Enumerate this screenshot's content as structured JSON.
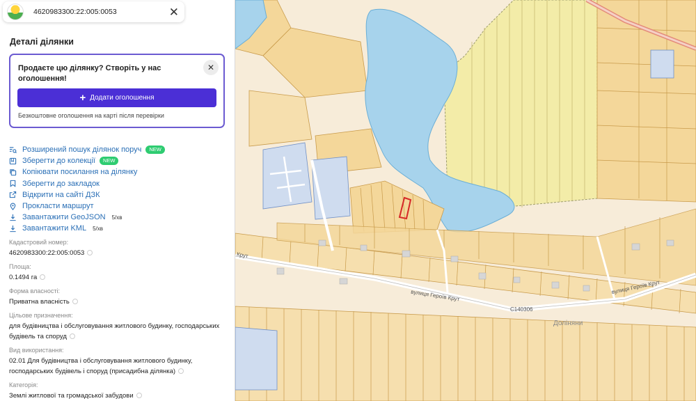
{
  "search": {
    "value": "4620983300:22:005:0053"
  },
  "details": {
    "title": "Деталі ділянки"
  },
  "promo": {
    "text": "Продаєте цю ділянку? Створіть у нас оголошення!",
    "button": "Додати оголошення",
    "note": "Безкоштовне оголошення на карті після перевірки"
  },
  "actions": [
    {
      "label": "Розширений пошук ділянок поруч",
      "icon": "list-search-icon",
      "badge": "NEW"
    },
    {
      "label": "Зберегти до колекції",
      "icon": "collection-icon",
      "badge": "NEW"
    },
    {
      "label": "Копіювати посилання на ділянку",
      "icon": "copy-icon"
    },
    {
      "label": "Зберегти до закладок",
      "icon": "bookmark-icon"
    },
    {
      "label": "Відкрити на сайті ДЗК",
      "icon": "external-link-icon"
    },
    {
      "label": "Прокласти маршрут",
      "icon": "map-pin-icon"
    },
    {
      "label": "Завантажити GeoJSON",
      "icon": "download-icon",
      "quota": "5/хв"
    },
    {
      "label": "Завантажити KML",
      "icon": "download-icon",
      "quota": "5/хв"
    }
  ],
  "properties": [
    {
      "label": "Кадастровий номер:",
      "value": "4620983300:22:005:0053"
    },
    {
      "label": "Площа:",
      "value": "0.1494 га"
    },
    {
      "label": "Форма власності:",
      "value": "Приватна власність"
    },
    {
      "label": "Цільове призначення:",
      "value": "для будівництва і обслуговування житлового будинку, господарських будівель та споруд"
    },
    {
      "label": "Вид використання:",
      "value": "02.01 Для будівництва і обслуговування житлового будинку, господарських будівель і споруд (присадибна ділянка)"
    },
    {
      "label": "Категорія:",
      "value": "Землі житлової та громадської забудови"
    }
  ],
  "map": {
    "street_left": "Крут",
    "street_center": "вулиця Героїв Крут",
    "street_right": "вулиця Героїв Крут",
    "road_code": "C140306",
    "settlement": "Доліняни"
  },
  "colors": {
    "accent": "#4b2fd6",
    "link": "#2a6fb6",
    "badge": "#2ecc71",
    "water": "#a7d3ec",
    "parcel": "#f4d79a",
    "field": "#f3eca8",
    "selected_parcel": "#d62828"
  }
}
